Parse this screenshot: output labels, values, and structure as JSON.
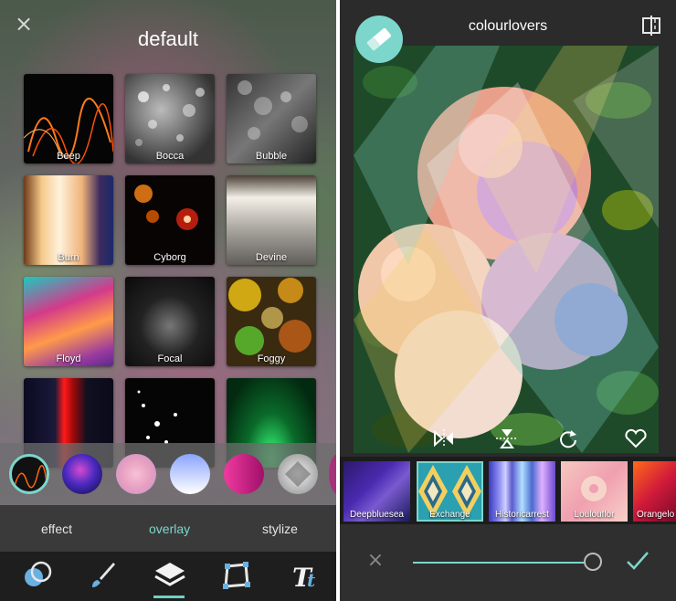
{
  "left": {
    "title": "default",
    "close_glyph": "×",
    "effects": [
      {
        "label": "Beep"
      },
      {
        "label": "Bocca"
      },
      {
        "label": "Bubble"
      },
      {
        "label": "Burn"
      },
      {
        "label": "Cyborg"
      },
      {
        "label": "Devine"
      },
      {
        "label": "Floyd"
      },
      {
        "label": "Focal"
      },
      {
        "label": "Foggy"
      }
    ],
    "modes": {
      "effect": "effect",
      "overlay": "overlay",
      "stylize": "stylize"
    },
    "active_mode": "overlay",
    "active_tool": "layers",
    "tools": [
      "circles-icon",
      "brush-icon",
      "layers-icon",
      "crop-shape-icon",
      "text-icon"
    ]
  },
  "right": {
    "title": "colourlovers",
    "filters": [
      {
        "label": "Deepbluesea"
      },
      {
        "label": "Exchange",
        "selected": true
      },
      {
        "label": "Historicarrest"
      },
      {
        "label": "Loulouflor"
      },
      {
        "label": "Orangelo"
      }
    ],
    "cancel_glyph": "×",
    "blend_level_percent": 100,
    "controls": [
      "flip-horizontal-icon",
      "flip-vertical-icon",
      "rotate-icon",
      "heart-icon"
    ]
  },
  "colors": {
    "accent": "#7dd6cc",
    "dark_bar": "#1e1e1e"
  }
}
